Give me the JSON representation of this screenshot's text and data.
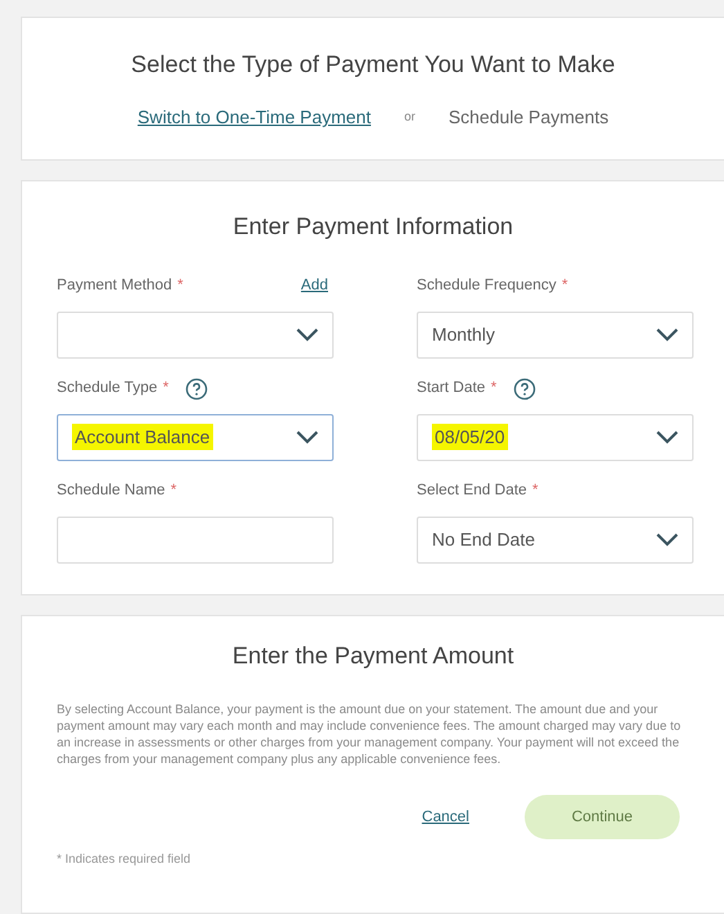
{
  "type_section": {
    "title": "Select the Type of Payment You Want to Make",
    "switch_link": "Switch to One-Time Payment",
    "separator": "or",
    "current": "Schedule Payments"
  },
  "info_section": {
    "title": "Enter Payment Information",
    "fields": [
      {
        "kind": "select",
        "label": "Payment Method",
        "required_mark": "*",
        "action": "Add",
        "focused": false
      },
      {
        "kind": "select",
        "label": "Schedule Frequency",
        "required_mark": "*",
        "value": "Monthly",
        "focused": false
      },
      {
        "kind": "select",
        "label": "Schedule Type",
        "required_mark": "*",
        "help": true,
        "value": "Account Balance",
        "focused": true,
        "highlighted": true
      },
      {
        "kind": "select",
        "label": "Start Date",
        "required_mark": "*",
        "help": true,
        "value": "08/05/20",
        "focused": false,
        "highlighted": true
      },
      {
        "kind": "text",
        "label": "Schedule Name",
        "required_mark": "*",
        "focused": false
      },
      {
        "kind": "select",
        "label": "Select End Date",
        "required_mark": "*",
        "value": "No End Date",
        "focused": false
      }
    ]
  },
  "amount_section": {
    "title": "Enter the Payment Amount",
    "description": "By selecting Account Balance, your payment is the amount due on your statement. The amount due and your payment amount may vary each month and may include convenience fees. The amount charged may vary due to an increase in assessments or other charges from your management company. Your payment will not exceed the charges from your management company plus any applicable convenience fees.",
    "cancel": "Cancel",
    "continue": {
      "label": "Continue",
      "disabled": true
    },
    "footnote": "* Indicates required field"
  }
}
